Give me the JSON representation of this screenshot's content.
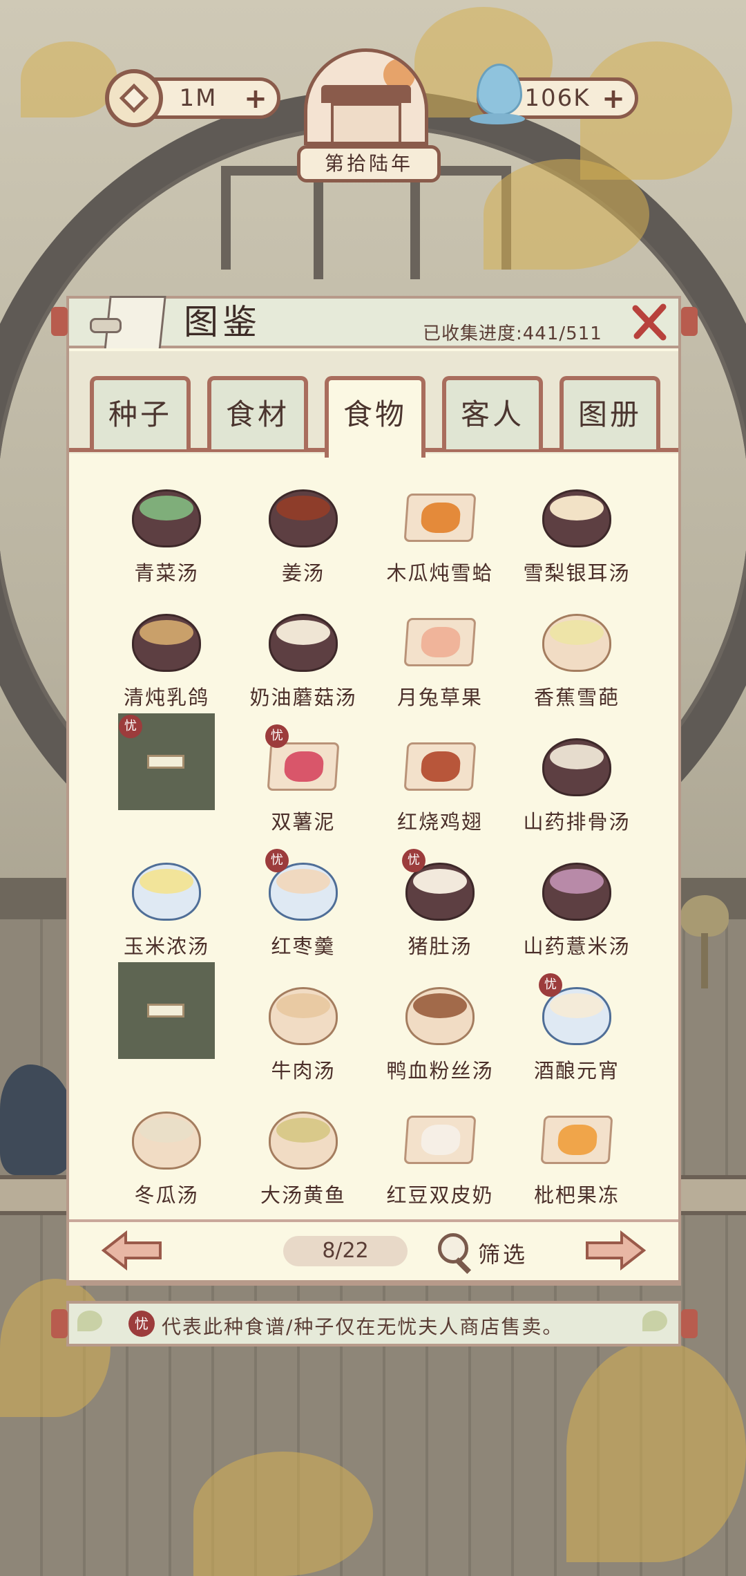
{
  "hud": {
    "coins": "1M",
    "water": "106K",
    "year": "第拾陆年"
  },
  "panel": {
    "title": "图鉴",
    "progress": "已收集进度:441/511"
  },
  "tabs": [
    {
      "label": "种子",
      "active": false
    },
    {
      "label": "食材",
      "active": false
    },
    {
      "label": "食物",
      "active": true
    },
    {
      "label": "客人",
      "active": false
    },
    {
      "label": "图册",
      "active": false
    }
  ],
  "items": [
    {
      "name": "青菜汤",
      "style": "bowl-dark",
      "soup": "#7fae7a",
      "exclusive": false,
      "locked": false
    },
    {
      "name": "姜汤",
      "style": "bowl-dark",
      "soup": "#8e3d2a",
      "exclusive": false,
      "locked": false
    },
    {
      "name": "木瓜炖雪蛤",
      "style": "plate",
      "soup": "#e48a3a",
      "exclusive": false,
      "locked": false
    },
    {
      "name": "雪梨银耳汤",
      "style": "bowl-dark",
      "soup": "#f2e2c6",
      "exclusive": false,
      "locked": false
    },
    {
      "name": "清炖乳鸽",
      "style": "bowl-dark",
      "soup": "#c9a06a",
      "exclusive": false,
      "locked": false
    },
    {
      "name": "奶油蘑菇汤",
      "style": "bowl-dark",
      "soup": "#efe5d4",
      "exclusive": false,
      "locked": false
    },
    {
      "name": "月兔草果",
      "style": "plate",
      "soup": "#f0b49a",
      "exclusive": false,
      "locked": false
    },
    {
      "name": "香蕉雪葩",
      "style": "bowl-cream",
      "soup": "#eee4a8",
      "exclusive": false,
      "locked": false
    },
    {
      "name": "",
      "style": "locked",
      "soup": "",
      "exclusive": true,
      "locked": true
    },
    {
      "name": "双薯泥",
      "style": "plate",
      "soup": "#d9566a",
      "exclusive": true,
      "locked": false
    },
    {
      "name": "红烧鸡翅",
      "style": "plate",
      "soup": "#b8563a",
      "exclusive": false,
      "locked": false
    },
    {
      "name": "山药排骨汤",
      "style": "bowl-dark",
      "soup": "#e6dccd",
      "exclusive": false,
      "locked": false
    },
    {
      "name": "玉米浓汤",
      "style": "bowl-blue",
      "soup": "#f2e49a",
      "exclusive": false,
      "locked": false
    },
    {
      "name": "红枣羹",
      "style": "bowl-blue",
      "soup": "#f0d9c0",
      "exclusive": true,
      "locked": false
    },
    {
      "name": "猪肚汤",
      "style": "bowl-dark",
      "soup": "#f2e9dc",
      "exclusive": true,
      "locked": false
    },
    {
      "name": "山药薏米汤",
      "style": "bowl-dark",
      "soup": "#b88aa8",
      "exclusive": false,
      "locked": false
    },
    {
      "name": "",
      "style": "locked",
      "soup": "",
      "exclusive": false,
      "locked": true
    },
    {
      "name": "牛肉汤",
      "style": "bowl-cream",
      "soup": "#e9caa3",
      "exclusive": false,
      "locked": false
    },
    {
      "name": "鸭血粉丝汤",
      "style": "bowl-cream",
      "soup": "#a26a4a",
      "exclusive": false,
      "locked": false
    },
    {
      "name": "酒酿元宵",
      "style": "bowl-blue",
      "soup": "#f4ebd9",
      "exclusive": true,
      "locked": false
    },
    {
      "name": "冬瓜汤",
      "style": "bowl-cream",
      "soup": "#eadfc8",
      "exclusive": false,
      "locked": false
    },
    {
      "name": "大汤黄鱼",
      "style": "bowl-cream",
      "soup": "#d9c98a",
      "exclusive": false,
      "locked": false
    },
    {
      "name": "红豆双皮奶",
      "style": "plate",
      "soup": "#f6efe6",
      "exclusive": false,
      "locked": false
    },
    {
      "name": "枇杷果冻",
      "style": "plate",
      "soup": "#f0a54a",
      "exclusive": false,
      "locked": false
    }
  ],
  "pagination": {
    "page": "8/22",
    "filter_label": "筛选"
  },
  "note": {
    "badge": "忧",
    "text": "代表此种食谱/种子仅在无忧夫人商店售卖。"
  },
  "colors": {
    "accent": "#a96d5d",
    "panel_bg": "#fbf8e3",
    "header_bg": "#e6ead9",
    "badge": "#9c3c3c",
    "close": "#b8413c"
  },
  "icons": {
    "coin": "coin-icon",
    "water": "water-drop-icon",
    "close": "close-icon",
    "filter": "magnifier-icon",
    "prev": "arrow-left-icon",
    "next": "arrow-right-icon"
  }
}
